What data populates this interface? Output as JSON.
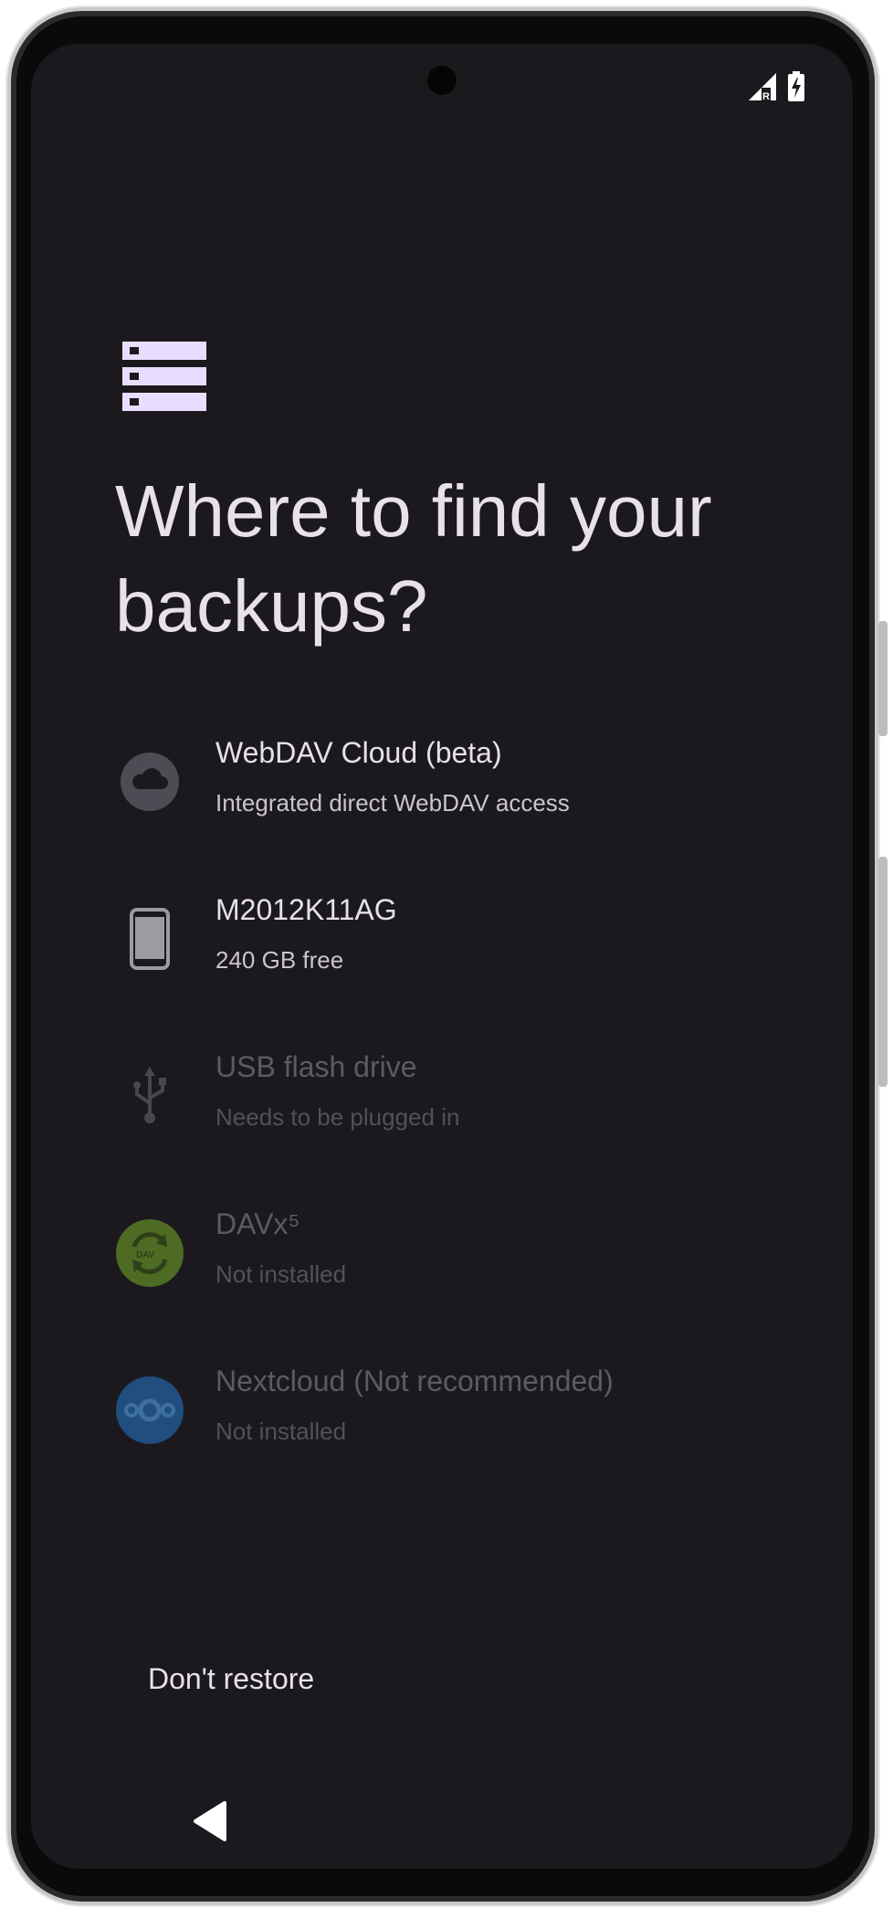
{
  "header": {
    "icon": "storage-icon",
    "title": "Where to find your backups?"
  },
  "locations": [
    {
      "label": "WebDAV Cloud (beta)",
      "sub": "Integrated direct WebDAV access",
      "icon": "cloud-icon",
      "enabled": true
    },
    {
      "label": "M2012K11AG",
      "sub": "240 GB free",
      "icon": "phone-icon",
      "enabled": true
    },
    {
      "label": "USB flash drive",
      "sub": "Needs to be plugged in",
      "icon": "usb-icon",
      "enabled": false
    },
    {
      "label": "DAVx⁵",
      "sub": "Not installed",
      "icon": "davx5-icon",
      "enabled": false
    },
    {
      "label": "Nextcloud (Not recommended)",
      "sub": "Not installed",
      "icon": "nextcloud-icon",
      "enabled": false
    }
  ],
  "actions": {
    "dont_restore": "Don't restore"
  },
  "colors": {
    "background": "#1b191e",
    "text_primary": "#e7e1e9",
    "accent_icon": "#e9ddff",
    "davx5_green": "#4e6b24",
    "nextcloud_blue": "#1f4e7f"
  }
}
